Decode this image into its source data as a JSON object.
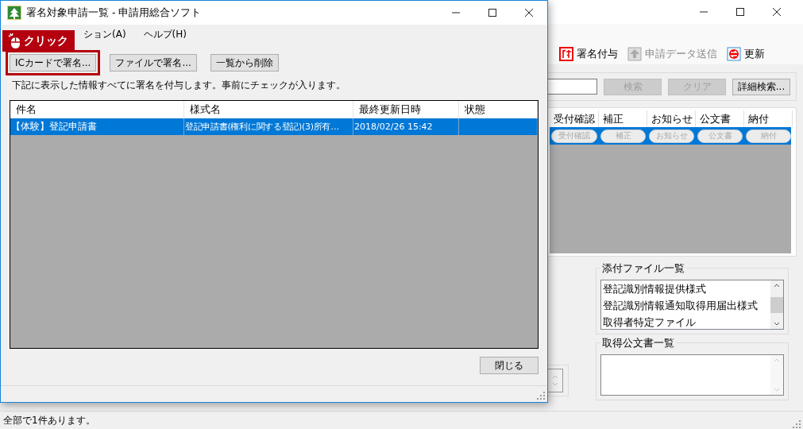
{
  "main_window": {
    "toolbar": [
      {
        "label": "署名付与",
        "kind": "seal",
        "disabled": false
      },
      {
        "label": "申請データ送信",
        "kind": "upload",
        "disabled": true
      },
      {
        "label": "更新",
        "kind": "refresh",
        "disabled": false
      }
    ],
    "search_buttons": [
      {
        "label": "検索",
        "disabled": true
      },
      {
        "label": "クリア",
        "disabled": true
      },
      {
        "label": "詳細検索...",
        "disabled": false
      }
    ],
    "table": {
      "columns": [
        "受付確認",
        "補正",
        "お知らせ",
        "公文書",
        "納付"
      ],
      "rows": [
        {
          "selected": true,
          "cells": [
            {
              "label": "受付確認",
              "disabled": true
            },
            {
              "label": "補正",
              "disabled": true
            },
            {
              "label": "お知らせ",
              "disabled": true
            },
            {
              "label": "公文書",
              "disabled": true
            },
            {
              "label": "納付",
              "disabled": true
            }
          ]
        }
      ]
    },
    "attachments": {
      "title": "添付ファイル一覧",
      "items": [
        "登記識別情報提供様式",
        "登記識別情報通知取得用届出様式",
        "取得者特定ファイル"
      ]
    },
    "documents": {
      "title": "取得公文書一覧"
    },
    "status_bar": "全部で1件あります。"
  },
  "dialog": {
    "title": "署名対象申請一覧 - 申請用総合ソフト",
    "menu": [
      "ション(A)",
      "ヘルプ(H)"
    ],
    "callout": "クリック",
    "buttons": [
      {
        "label": "ICカードで署名...",
        "highlighted": true
      },
      {
        "label": "ファイルで署名...",
        "highlighted": false
      },
      {
        "label": "一覧から削除",
        "highlighted": false
      }
    ],
    "note": "下記に表示した情報すべてに署名を付与します。事前にチェックが入ります。",
    "table": {
      "columns": [
        "件名",
        "様式名",
        "最終更新日時",
        "状態"
      ],
      "rows": [
        {
          "selected": true,
          "cells": [
            "【体験】登記申請書",
            "登記申請書(権利に関する登記)(3)所有…",
            "2018/02/26 15:42",
            ""
          ]
        }
      ]
    },
    "close_button": "閉じる"
  }
}
